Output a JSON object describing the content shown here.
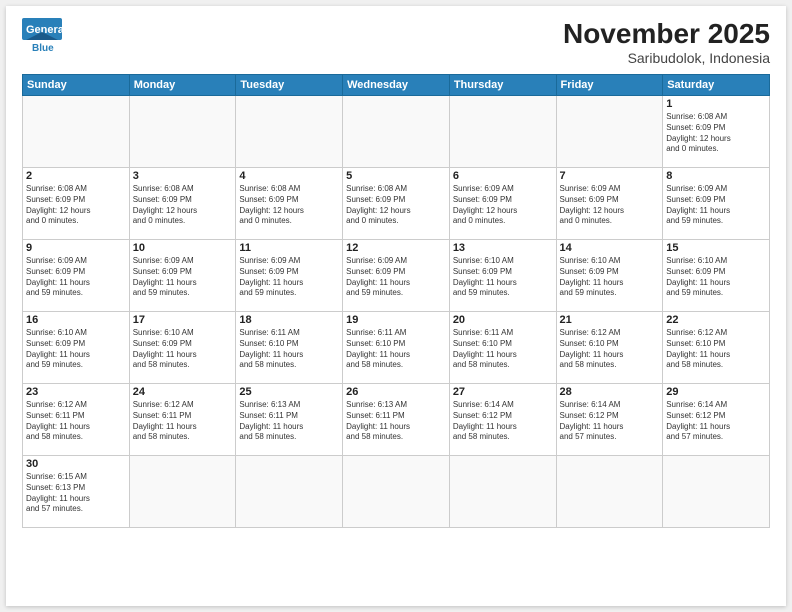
{
  "header": {
    "logo_line1": "General",
    "logo_line2": "Blue",
    "title": "November 2025",
    "subtitle": "Saribudolok, Indonesia"
  },
  "weekdays": [
    "Sunday",
    "Monday",
    "Tuesday",
    "Wednesday",
    "Thursday",
    "Friday",
    "Saturday"
  ],
  "weeks": [
    [
      {
        "day": "",
        "info": ""
      },
      {
        "day": "",
        "info": ""
      },
      {
        "day": "",
        "info": ""
      },
      {
        "day": "",
        "info": ""
      },
      {
        "day": "",
        "info": ""
      },
      {
        "day": "",
        "info": ""
      },
      {
        "day": "1",
        "info": "Sunrise: 6:08 AM\nSunset: 6:09 PM\nDaylight: 12 hours\nand 0 minutes."
      }
    ],
    [
      {
        "day": "2",
        "info": "Sunrise: 6:08 AM\nSunset: 6:09 PM\nDaylight: 12 hours\nand 0 minutes."
      },
      {
        "day": "3",
        "info": "Sunrise: 6:08 AM\nSunset: 6:09 PM\nDaylight: 12 hours\nand 0 minutes."
      },
      {
        "day": "4",
        "info": "Sunrise: 6:08 AM\nSunset: 6:09 PM\nDaylight: 12 hours\nand 0 minutes."
      },
      {
        "day": "5",
        "info": "Sunrise: 6:08 AM\nSunset: 6:09 PM\nDaylight: 12 hours\nand 0 minutes."
      },
      {
        "day": "6",
        "info": "Sunrise: 6:09 AM\nSunset: 6:09 PM\nDaylight: 12 hours\nand 0 minutes."
      },
      {
        "day": "7",
        "info": "Sunrise: 6:09 AM\nSunset: 6:09 PM\nDaylight: 12 hours\nand 0 minutes."
      },
      {
        "day": "8",
        "info": "Sunrise: 6:09 AM\nSunset: 6:09 PM\nDaylight: 11 hours\nand 59 minutes."
      }
    ],
    [
      {
        "day": "9",
        "info": "Sunrise: 6:09 AM\nSunset: 6:09 PM\nDaylight: 11 hours\nand 59 minutes."
      },
      {
        "day": "10",
        "info": "Sunrise: 6:09 AM\nSunset: 6:09 PM\nDaylight: 11 hours\nand 59 minutes."
      },
      {
        "day": "11",
        "info": "Sunrise: 6:09 AM\nSunset: 6:09 PM\nDaylight: 11 hours\nand 59 minutes."
      },
      {
        "day": "12",
        "info": "Sunrise: 6:09 AM\nSunset: 6:09 PM\nDaylight: 11 hours\nand 59 minutes."
      },
      {
        "day": "13",
        "info": "Sunrise: 6:10 AM\nSunset: 6:09 PM\nDaylight: 11 hours\nand 59 minutes."
      },
      {
        "day": "14",
        "info": "Sunrise: 6:10 AM\nSunset: 6:09 PM\nDaylight: 11 hours\nand 59 minutes."
      },
      {
        "day": "15",
        "info": "Sunrise: 6:10 AM\nSunset: 6:09 PM\nDaylight: 11 hours\nand 59 minutes."
      }
    ],
    [
      {
        "day": "16",
        "info": "Sunrise: 6:10 AM\nSunset: 6:09 PM\nDaylight: 11 hours\nand 59 minutes."
      },
      {
        "day": "17",
        "info": "Sunrise: 6:10 AM\nSunset: 6:09 PM\nDaylight: 11 hours\nand 58 minutes."
      },
      {
        "day": "18",
        "info": "Sunrise: 6:11 AM\nSunset: 6:10 PM\nDaylight: 11 hours\nand 58 minutes."
      },
      {
        "day": "19",
        "info": "Sunrise: 6:11 AM\nSunset: 6:10 PM\nDaylight: 11 hours\nand 58 minutes."
      },
      {
        "day": "20",
        "info": "Sunrise: 6:11 AM\nSunset: 6:10 PM\nDaylight: 11 hours\nand 58 minutes."
      },
      {
        "day": "21",
        "info": "Sunrise: 6:12 AM\nSunset: 6:10 PM\nDaylight: 11 hours\nand 58 minutes."
      },
      {
        "day": "22",
        "info": "Sunrise: 6:12 AM\nSunset: 6:10 PM\nDaylight: 11 hours\nand 58 minutes."
      }
    ],
    [
      {
        "day": "23",
        "info": "Sunrise: 6:12 AM\nSunset: 6:11 PM\nDaylight: 11 hours\nand 58 minutes."
      },
      {
        "day": "24",
        "info": "Sunrise: 6:12 AM\nSunset: 6:11 PM\nDaylight: 11 hours\nand 58 minutes."
      },
      {
        "day": "25",
        "info": "Sunrise: 6:13 AM\nSunset: 6:11 PM\nDaylight: 11 hours\nand 58 minutes."
      },
      {
        "day": "26",
        "info": "Sunrise: 6:13 AM\nSunset: 6:11 PM\nDaylight: 11 hours\nand 58 minutes."
      },
      {
        "day": "27",
        "info": "Sunrise: 6:14 AM\nSunset: 6:12 PM\nDaylight: 11 hours\nand 58 minutes."
      },
      {
        "day": "28",
        "info": "Sunrise: 6:14 AM\nSunset: 6:12 PM\nDaylight: 11 hours\nand 57 minutes."
      },
      {
        "day": "29",
        "info": "Sunrise: 6:14 AM\nSunset: 6:12 PM\nDaylight: 11 hours\nand 57 minutes."
      }
    ],
    [
      {
        "day": "30",
        "info": "Sunrise: 6:15 AM\nSunset: 6:13 PM\nDaylight: 11 hours\nand 57 minutes."
      },
      {
        "day": "",
        "info": ""
      },
      {
        "day": "",
        "info": ""
      },
      {
        "day": "",
        "info": ""
      },
      {
        "day": "",
        "info": ""
      },
      {
        "day": "",
        "info": ""
      },
      {
        "day": "",
        "info": ""
      }
    ]
  ]
}
